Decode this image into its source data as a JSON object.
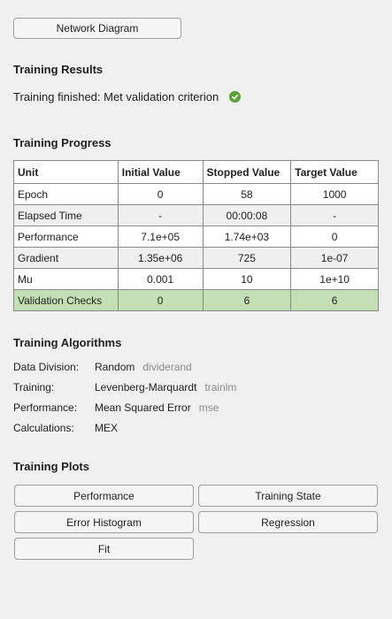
{
  "buttons": {
    "network_diagram": "Network Diagram"
  },
  "results": {
    "title": "Training Results",
    "status": "Training finished: Met validation criterion",
    "status_color": "#5aa532"
  },
  "progress": {
    "title": "Training Progress",
    "headers": [
      "Unit",
      "Initial Value",
      "Stopped Value",
      "Target Value"
    ],
    "rows": [
      [
        "Epoch",
        "0",
        "58",
        "1000"
      ],
      [
        "Elapsed Time",
        "-",
        "00:00:08",
        "-"
      ],
      [
        "Performance",
        "7.1e+05",
        "1.74e+03",
        "0"
      ],
      [
        "Gradient",
        "1.35e+06",
        "725",
        "1e-07"
      ],
      [
        "Mu",
        "0.001",
        "10",
        "1e+10"
      ],
      [
        "Validation Checks",
        "0",
        "6",
        "6"
      ]
    ],
    "highlight_color": "#c3e0b5"
  },
  "algorithms": {
    "title": "Training Algorithms",
    "items": [
      {
        "label": "Data Division:",
        "value": "Random",
        "fn": "dividerand"
      },
      {
        "label": "Training:",
        "value": "Levenberg-Marquardt",
        "fn": "trainlm"
      },
      {
        "label": "Performance:",
        "value": "Mean Squared Error",
        "fn": "mse"
      },
      {
        "label": "Calculations:",
        "value": "MEX",
        "fn": ""
      }
    ]
  },
  "plots": {
    "title": "Training Plots",
    "performance": "Performance",
    "training_state": "Training State",
    "error_histogram": "Error Histogram",
    "regression": "Regression",
    "fit": "Fit"
  }
}
